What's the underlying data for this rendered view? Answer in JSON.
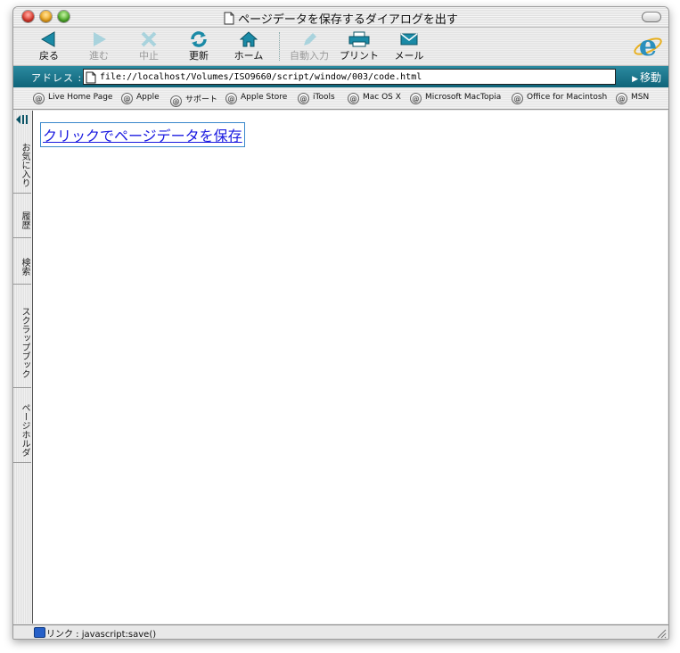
{
  "window": {
    "title": "ページデータを保存するダイアログを出す"
  },
  "toolbar": {
    "back": "戻る",
    "forward": "進む",
    "stop": "中止",
    "refresh": "更新",
    "home": "ホーム",
    "autofill": "自動入力",
    "print": "プリント",
    "mail": "メール"
  },
  "address": {
    "label": "アドレス :",
    "url": "file://localhost/Volumes/ISO9660/script/window/003/code.html",
    "go": "移動"
  },
  "favorites": [
    "Live Home Page",
    "Apple",
    "サポート",
    "Apple Store",
    "iTools",
    "Mac OS X",
    "Microsoft MacTopia",
    "Office for Macintosh",
    "MSN"
  ],
  "sidebar": {
    "tabs": [
      "お気に入り",
      "履歴",
      "検索",
      "スクラップブック",
      "ページホルダ"
    ]
  },
  "content": {
    "link": "クリックでページデータを保存"
  },
  "status": {
    "text": "リンク : javascript:save()"
  },
  "colors": {
    "address_bar": "#0f6479",
    "icon_teal": "#1a8aa6",
    "link": "#1a1ae0"
  }
}
